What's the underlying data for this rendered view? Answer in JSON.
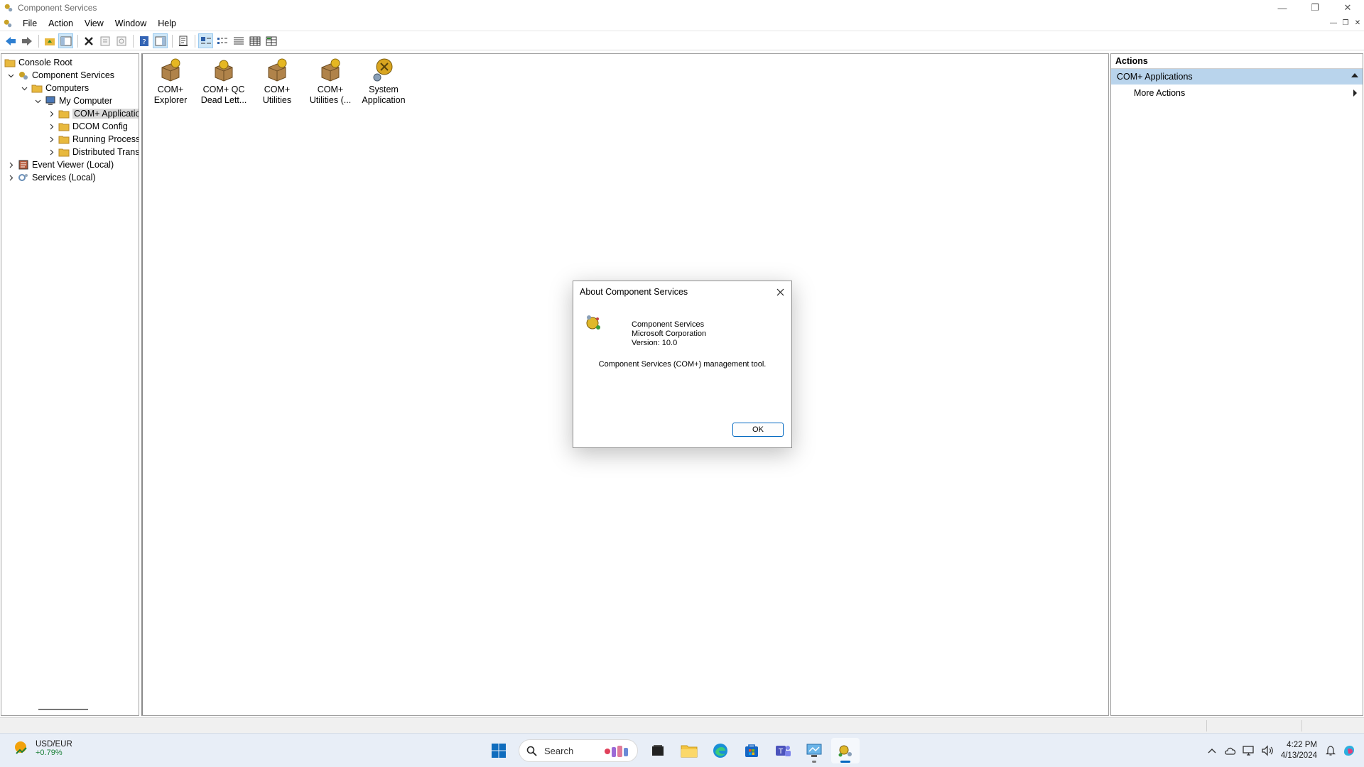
{
  "window": {
    "title": "Component Services"
  },
  "menu": [
    "File",
    "Action",
    "View",
    "Window",
    "Help"
  ],
  "tree": {
    "console_root": "Console Root",
    "component_services": "Component Services",
    "computers": "Computers",
    "my_computer": "My Computer",
    "com_apps": "COM+ Applications",
    "dcom_config": "DCOM Config",
    "running_processes": "Running Processes",
    "distributed_trans": "Distributed Transaction Coordinator",
    "event_viewer": "Event Viewer (Local)",
    "services": "Services (Local)"
  },
  "results": [
    {
      "line1": "COM+",
      "line2": "Explorer"
    },
    {
      "line1": "COM+ QC",
      "line2": "Dead Lett..."
    },
    {
      "line1": "COM+",
      "line2": "Utilities"
    },
    {
      "line1": "COM+",
      "line2": "Utilities (..."
    },
    {
      "line1": "System",
      "line2": "Application"
    }
  ],
  "actions": {
    "header": "Actions",
    "section": "COM+ Applications",
    "more": "More Actions"
  },
  "dialog": {
    "title": "About Component Services",
    "product": "Component Services",
    "company": "Microsoft Corporation",
    "version": "Version: 10.0",
    "description": "Component Services (COM+) management tool.",
    "ok": "OK"
  },
  "taskbar": {
    "widget_title": "USD/EUR",
    "widget_value": "+0.79%",
    "search_placeholder": "Search",
    "time": "4:22 PM",
    "date": "4/13/2024"
  },
  "colors": {
    "accent": "#0067c0",
    "selection": "#b9d4ec",
    "folder": "#e8b93e"
  }
}
